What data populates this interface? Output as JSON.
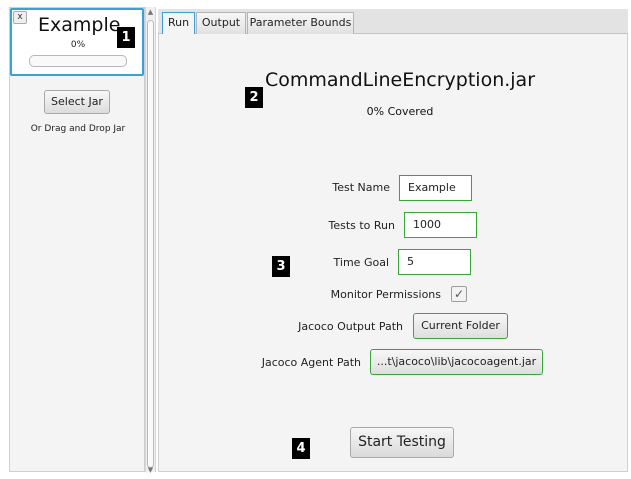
{
  "sidebar": {
    "card": {
      "close_label": "x",
      "title": "Example",
      "percent": "0%",
      "progress": 0
    },
    "select_jar_label": "Select Jar",
    "drag_drop_text": "Or Drag and Drop Jar"
  },
  "scrollbar": {
    "up_glyph": "▲",
    "down_glyph": "▼"
  },
  "tabs": [
    {
      "label": "Run",
      "selected": true
    },
    {
      "label": "Output",
      "selected": false
    },
    {
      "label": "Parameter Bounds",
      "selected": false
    }
  ],
  "main": {
    "jar_name": "CommandLineEncryption.jar",
    "coverage": "0% Covered",
    "form": {
      "test_name_label": "Test Name",
      "test_name_value": "Example",
      "tests_to_run_label": "Tests to Run",
      "tests_to_run_value": "1000",
      "time_goal_label": "Time Goal",
      "time_goal_value": "5",
      "monitor_label": "Monitor Permissions",
      "monitor_checked": true,
      "monitor_check_glyph": "✓",
      "jacoco_output_label": "Jacoco Output Path",
      "jacoco_output_button": "Current Folder",
      "jacoco_agent_label": "Jacoco Agent Path",
      "jacoco_agent_button": "...t\\jacoco\\lib\\jacocoagent.jar"
    },
    "start_label": "Start Testing"
  },
  "annotations": [
    "1",
    "2",
    "3",
    "4"
  ],
  "colors": {
    "selection_blue": "#3aa0d8",
    "valid_green": "#3aa63a",
    "panel_bg": "#f4f4f4"
  }
}
